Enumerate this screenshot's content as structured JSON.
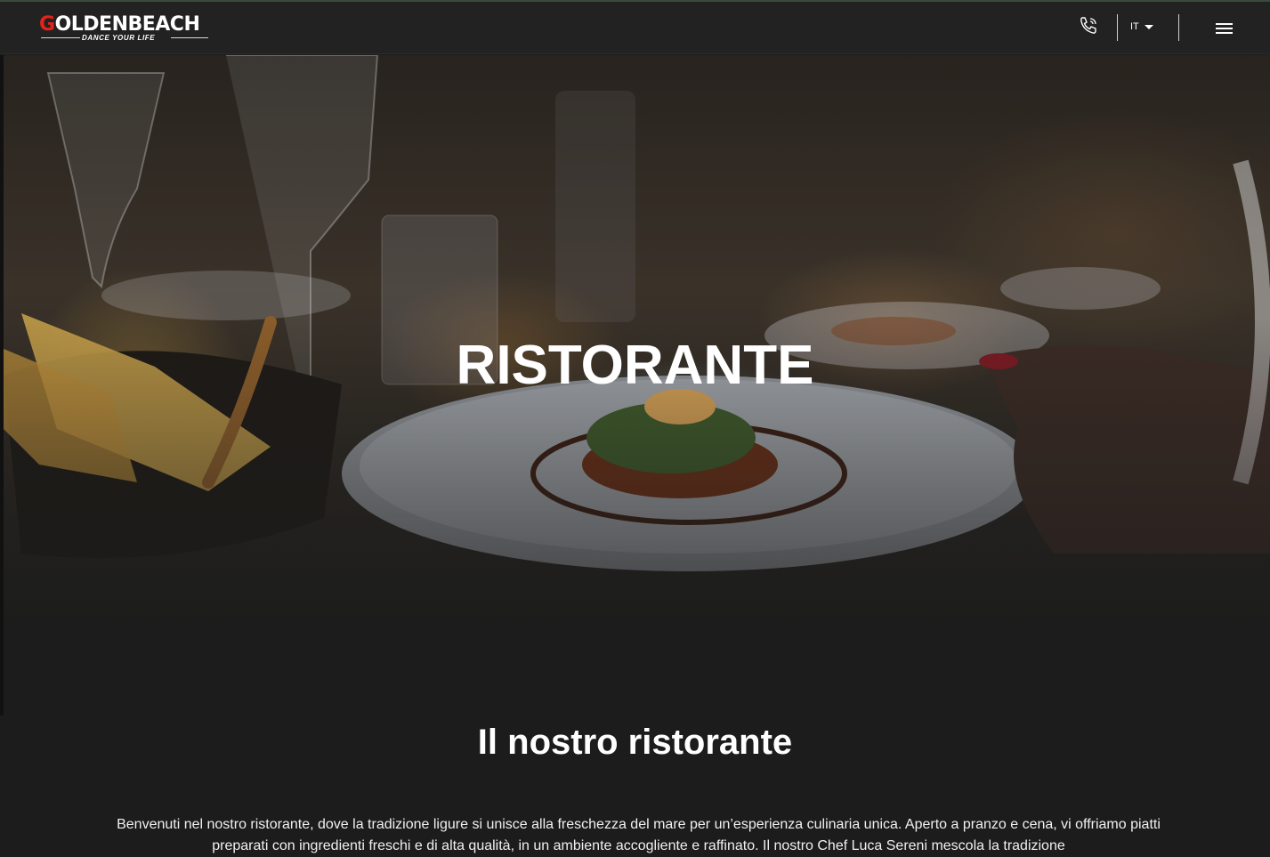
{
  "header": {
    "logo_text_first": "G",
    "logo_text_rest": "OLDENBEACH",
    "logo_tagline": "DANCE YOUR LIFE",
    "language": "IT",
    "phone_icon": "phone-icon",
    "menu_icon": "hamburger-menu-icon"
  },
  "hero": {
    "title": "RISTORANTE"
  },
  "main": {
    "section_title": "Il nostro ristorante",
    "intro_text": "Benvenuti nel nostro ristorante, dove la tradizione ligure si unisce alla freschezza del mare per un’esperienza culinaria unica. Aperto a pranzo e cena, vi offriamo piatti preparati con ingredienti freschi e di alta qualità, in un ambiente accogliente e raffinato. Il nostro Chef Luca Sereni mescola la tradizione"
  },
  "colors": {
    "accent": "#e2231a",
    "header_bg": "#222222",
    "page_bg": "#1c1c1c"
  }
}
